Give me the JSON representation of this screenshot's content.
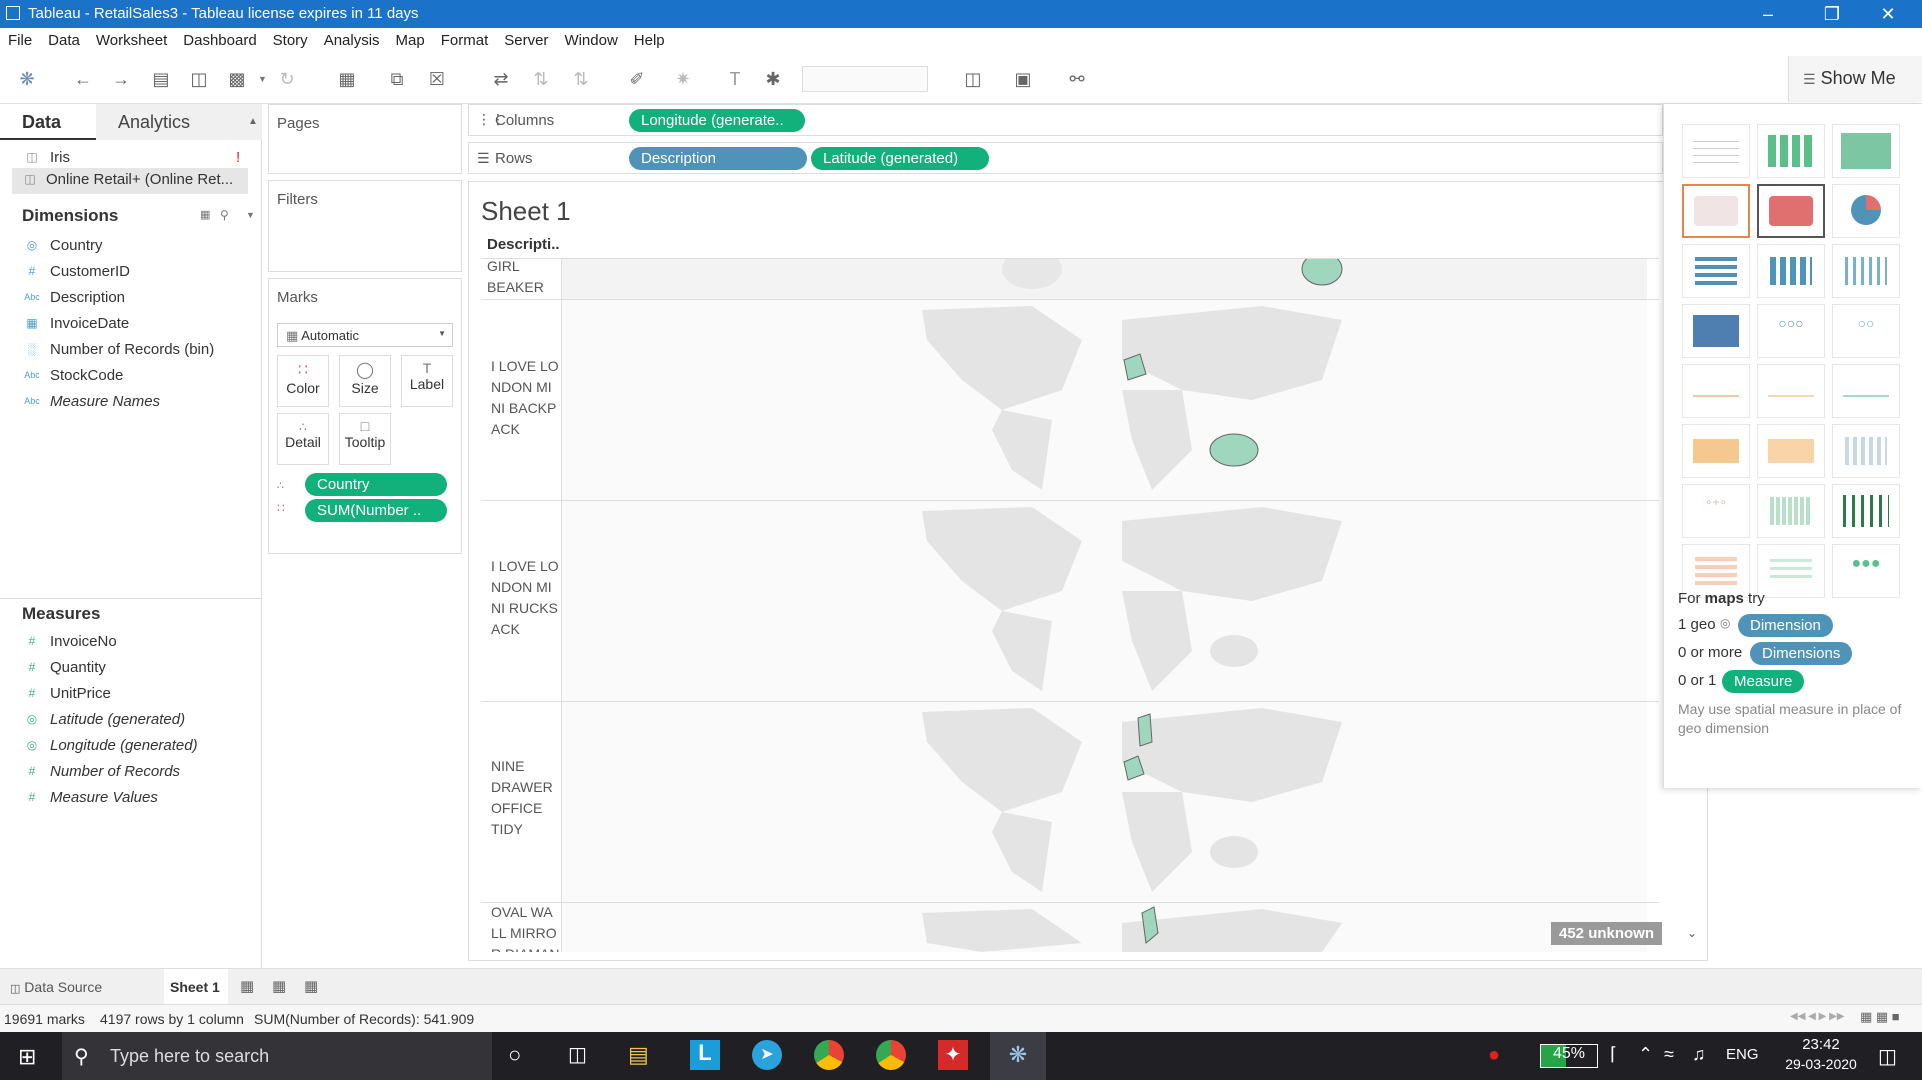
{
  "window": {
    "title": "Tableau - RetailSales3 - Tableau license expires in 11 days"
  },
  "menu": [
    "File",
    "Data",
    "Worksheet",
    "Dashboard",
    "Story",
    "Analysis",
    "Map",
    "Format",
    "Server",
    "Window",
    "Help"
  ],
  "toolbar": {
    "show_me_label": "Show Me"
  },
  "data_pane": {
    "tab_data": "Data",
    "tab_analytics": "Analytics",
    "sources": [
      {
        "name": "Iris",
        "warning": "!"
      },
      {
        "name": "Online Retail+ (Online Ret..."
      }
    ],
    "dimensions_title": "Dimensions",
    "dimensions": [
      {
        "icon": "globe-icon",
        "name": "Country"
      },
      {
        "icon": "hash-icon",
        "name": "CustomerID"
      },
      {
        "icon": "abc-icon",
        "name": "Description"
      },
      {
        "icon": "calendar-icon",
        "name": "InvoiceDate"
      },
      {
        "icon": "histogram-icon",
        "name": "Number of Records (bin)"
      },
      {
        "icon": "abc-icon",
        "name": "StockCode"
      },
      {
        "icon": "abc-icon",
        "name": "Measure Names"
      }
    ],
    "measures_title": "Measures",
    "measures": [
      {
        "icon": "hash-icon",
        "name": "InvoiceNo"
      },
      {
        "icon": "hash-icon",
        "name": "Quantity"
      },
      {
        "icon": "hash-icon",
        "name": "UnitPrice"
      },
      {
        "icon": "globe-icon",
        "name": "Latitude (generated)"
      },
      {
        "icon": "globe-icon",
        "name": "Longitude (generated)"
      },
      {
        "icon": "hash-icon",
        "name": "Number of Records"
      },
      {
        "icon": "hash-icon",
        "name": "Measure Values"
      }
    ]
  },
  "cards": {
    "pages": "Pages",
    "filters": "Filters",
    "marks": "Marks",
    "mark_type": "Automatic",
    "mark_buttons": [
      "Color",
      "Size",
      "Label",
      "Detail",
      "Tooltip"
    ],
    "mark_pills": [
      {
        "icon": "detail-icon",
        "label": "Country"
      },
      {
        "icon": "color-icon",
        "label": "SUM(Number .."
      }
    ]
  },
  "shelves": {
    "columns_label": "Columns",
    "rows_label": "Rows",
    "columns_pills": [
      "Longitude (generate.."
    ],
    "rows_pills": [
      "Description",
      "Latitude (generated)"
    ]
  },
  "sheet": {
    "title": "Sheet 1",
    "row_header": "Descripti..",
    "rows": [
      {
        "label": "GIRL\nBEAKER"
      },
      {
        "label": "I LOVE LO\nNDON MI\nNI BACKP\nACK"
      },
      {
        "label": "I LOVE LO\nNDON MI\nNI RUCKS\nACK"
      },
      {
        "label": "NINE\nDRAWER\nOFFICE\nTIDY"
      },
      {
        "label": "OVAL WA\nLL MIRRO\nR DIAMAN"
      }
    ],
    "unknown_badge": "452 unknown"
  },
  "show_me": {
    "hint_prefix": "For ",
    "hint_bold": "maps",
    "hint_suffix": " try",
    "req1_text": "1 geo",
    "req1_pill": "Dimension",
    "req2_text": "0 or more",
    "req2_pill": "Dimensions",
    "req3_text": "0 or 1",
    "req3_pill": "Measure",
    "note": "May use spatial measure in place of geo dimension"
  },
  "bottom_tabs": {
    "data_source": "Data Source",
    "sheet1": "Sheet 1"
  },
  "status": {
    "marks": "19691 marks",
    "rows": "4197 rows by 1 column",
    "sum": "SUM(Number of Records): 541.909"
  },
  "taskbar": {
    "search_placeholder": "Type here to search",
    "battery": "45%",
    "lang": "ENG",
    "time": "23:42",
    "date": "29-03-2020"
  }
}
